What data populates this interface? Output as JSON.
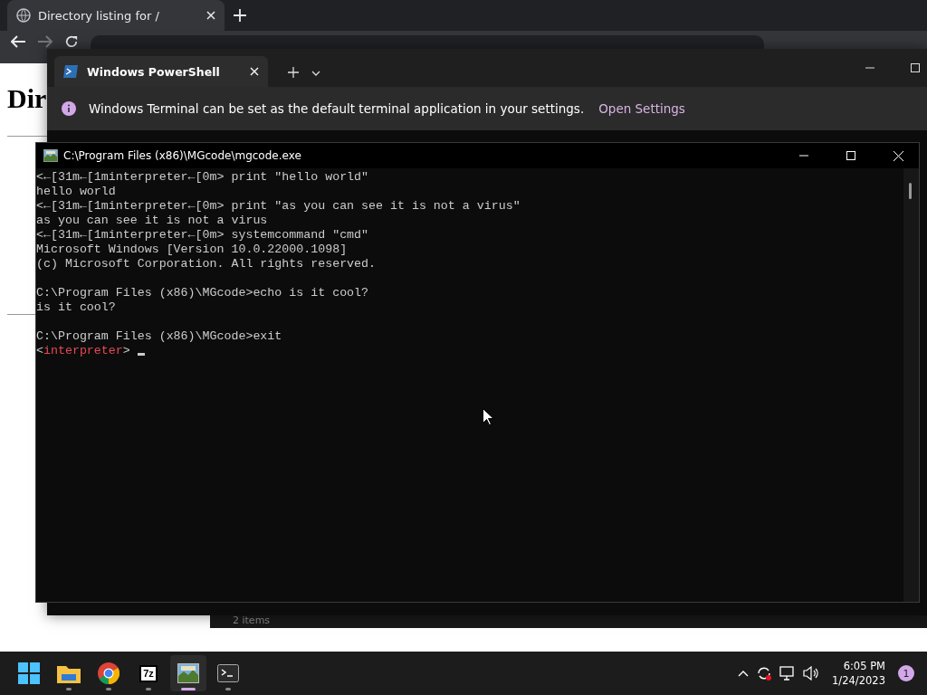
{
  "browser": {
    "tab": {
      "title": "Directory listing for /"
    },
    "page": {
      "heading": "Dir"
    }
  },
  "terminal": {
    "tab": {
      "title": "Windows PowerShell"
    },
    "notice": {
      "text": "Windows Terminal can be set as the default terminal application in your settings.",
      "link": "Open Settings"
    }
  },
  "explorer": {
    "status": "2 items"
  },
  "console": {
    "title": "C:\\Program Files (x86)\\MGcode\\mgcode.exe",
    "lines": [
      {
        "kind": "plain",
        "text": "<←[31m←[1minterpreter←[0m> print \"hello world\""
      },
      {
        "kind": "plain",
        "text": "hello world"
      },
      {
        "kind": "plain",
        "text": "<←[31m←[1minterpreter←[0m> print \"as you can see it is not a virus\""
      },
      {
        "kind": "plain",
        "text": "as you can see it is not a virus"
      },
      {
        "kind": "plain",
        "text": "<←[31m←[1minterpreter←[0m> systemcommand \"cmd\""
      },
      {
        "kind": "plain",
        "text": "Microsoft Windows [Version 10.0.22000.1098]"
      },
      {
        "kind": "plain",
        "text": "(c) Microsoft Corporation. All rights reserved."
      },
      {
        "kind": "blank"
      },
      {
        "kind": "plain",
        "text": "C:\\Program Files (x86)\\MGcode>echo is it cool?"
      },
      {
        "kind": "plain",
        "text": "is it cool?"
      },
      {
        "kind": "blank"
      },
      {
        "kind": "plain",
        "text": "C:\\Program Files (x86)\\MGcode>exit"
      },
      {
        "kind": "prompt",
        "parts": [
          "<",
          "interpreter",
          ">"
        ]
      }
    ]
  },
  "taskbar": {
    "apps": [
      {
        "kind": "start",
        "selected": false
      },
      {
        "kind": "folder",
        "selected": false
      },
      {
        "kind": "chrome",
        "selected": false
      },
      {
        "kind": "sevenzip",
        "text": "7z",
        "selected": false
      },
      {
        "kind": "mgcode",
        "selected": true
      },
      {
        "kind": "terminal",
        "selected": false
      }
    ],
    "clock": {
      "time": "6:05 PM",
      "date": "1/24/2023"
    },
    "notifications": "1"
  }
}
